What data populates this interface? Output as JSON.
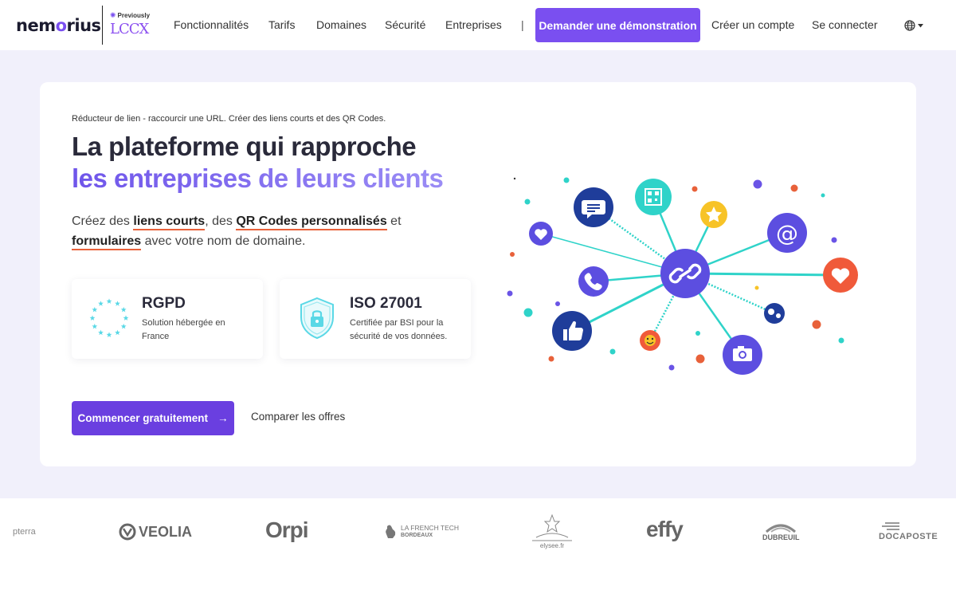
{
  "nav": {
    "logo_prefix": "nem",
    "logo_o": "o",
    "logo_suffix": "rius",
    "previously": "Previously",
    "previous_brand": "LCCX",
    "links": [
      "Fonctionnalités",
      "Tarifs",
      "Domaines",
      "Sécurité",
      "Entreprises"
    ],
    "separator": "|",
    "demo_label": "Demander une démonstration",
    "create_account": "Créer un compte",
    "login": "Se connecter",
    "language_icon": "globe-icon"
  },
  "hero": {
    "tagline": "Réducteur de lien - raccourcir une URL. Créer des liens courts et des QR Codes.",
    "title_line1": "La plateforme qui rapproche",
    "title_line2": "les entreprises de leurs clients",
    "sub_1": "Créez des ",
    "sub_b1": "liens courts",
    "sub_2": ", des ",
    "sub_b2": "QR Codes personnalisés",
    "sub_3": " et ",
    "sub_b3": "formulaires",
    "sub_4": " avec votre nom de domaine.",
    "features": [
      {
        "title": "RGPD",
        "desc": "Solution hébergée en France",
        "icon": "eu-stars-icon"
      },
      {
        "title": "ISO 27001",
        "desc": "Certifiée par BSI pour la sécurité de vos données.",
        "icon": "shield-lock-icon"
      }
    ],
    "cta_label": "Commencer gratuitement",
    "cta_arrow": "→",
    "compare_label": "Comparer les offres"
  },
  "brands": {
    "b0": "pterra",
    "b1": "VEOLIA",
    "b2": "Orpi",
    "b3_line1": "LA FRENCH TECH",
    "b3_line2": "BORDEAUX",
    "b4": "elysee.fr",
    "b5": "effy",
    "b6": "DUBREUIL",
    "b7": "DOCAPOSTE"
  },
  "colors": {
    "accent": "#7a4ff0",
    "cta": "#6a3fe0",
    "hero_bg": "#f1f0fb",
    "underline": "#e8613a"
  }
}
